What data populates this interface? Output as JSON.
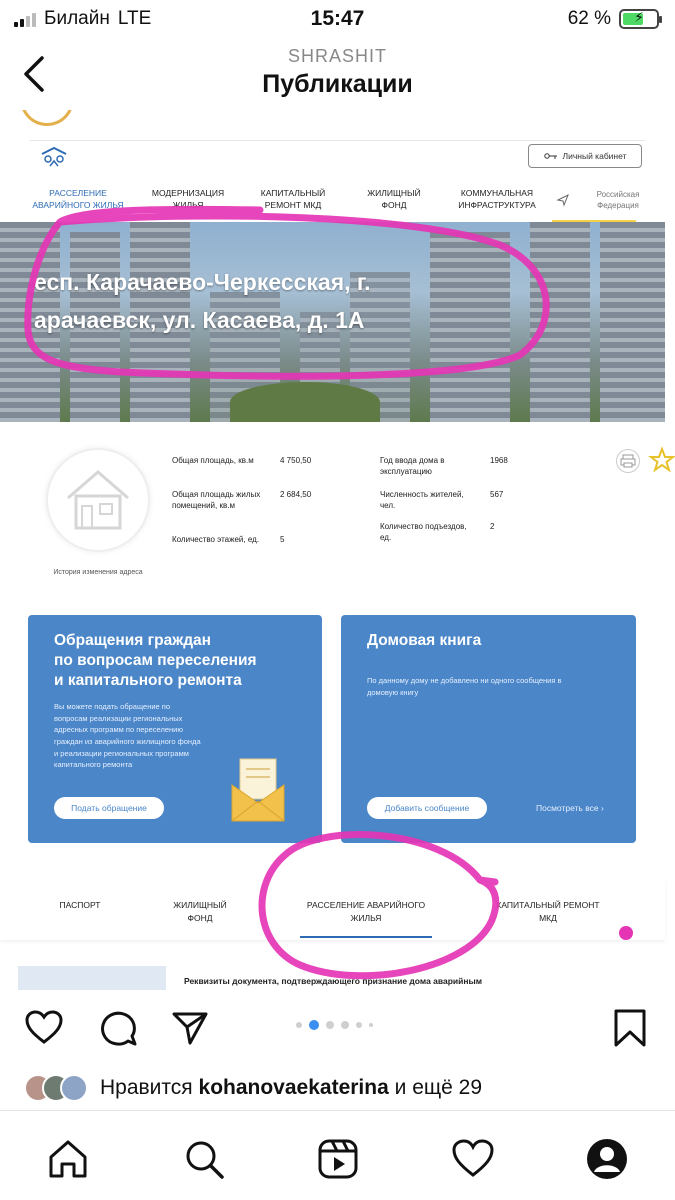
{
  "status_bar": {
    "carrier": "Билайн",
    "network": "LTE",
    "time": "15:47",
    "battery": "62 %",
    "battery_level": 0.62,
    "battery_color": "#4cd964"
  },
  "header": {
    "username": "SHRASHIT",
    "title": "Публикации",
    "back_icon": "chevron-left-icon"
  },
  "post": {
    "site": {
      "cabinet_label": "Личный кабинет",
      "nav": [
        {
          "label": "Расселение аварийного жилья",
          "line1": "Расселение",
          "line2": "аварийного жилья"
        },
        {
          "label": "Модернизация жилья",
          "line1": "Модернизация",
          "line2": "жилья"
        },
        {
          "label": "Капитальный ремонт МКД",
          "line1": "Капитальный",
          "line2": "ремонт МКД"
        },
        {
          "label": "Жилищный фонд",
          "line1": "Жилищный",
          "line2": "фонд"
        },
        {
          "label": "Коммунальная инфраструктура",
          "line1": "Коммунальная",
          "line2": "инфраструктура"
        },
        {
          "label": "Российская Федерация",
          "line1": "Российская",
          "line2": "Федерация"
        }
      ],
      "address_line1": "есп. Карачаево-Черкесская, г.",
      "address_line2": "арачаевск, ул. Касаева, д. 1А",
      "photo_caption": "История изменения адреса",
      "properties_left": [
        {
          "label": "Общая площадь, кв.м",
          "value": "4 750,50"
        },
        {
          "label": "Общая площадь жилых помещений, кв.м",
          "value": "2 684,50"
        },
        {
          "label": "Количество этажей, ед.",
          "value": "5"
        }
      ],
      "properties_right": [
        {
          "label": "Год ввода дома в эксплуатацию",
          "value": "1968"
        },
        {
          "label": "Численность жителей, чел.",
          "value": "567"
        },
        {
          "label": "Количество подъездов, ед.",
          "value": "2"
        }
      ],
      "card_appeal": {
        "title_line1": "Обращения граждан",
        "title_line2": "по вопросам переселения",
        "title_line3": "и капитального ремонта",
        "text_lines": [
          "Вы можете подать обращение по",
          "вопросам реализации региональных",
          "адресных программ по переселению",
          "граждан из аварийного жилищного фонда",
          "и реализации региональных программ",
          "капитального ремонта"
        ],
        "button": "Подать обращение"
      },
      "card_book": {
        "title": "Домовая книга",
        "text_line1": "По данному дому не добавлено ни одного сообщения в",
        "text_line2": "домовую книгу",
        "button": "Добавить сообщение",
        "see_all": "Посмотреть все ›"
      },
      "tabs": [
        {
          "line1": "Паспорт",
          "line2": ""
        },
        {
          "line1": "Жилищный",
          "line2": "фонд"
        },
        {
          "line1": "Расселение аварийного",
          "line2": "жилья"
        },
        {
          "line1": "Капитальный ремонт",
          "line2": "МКД"
        }
      ],
      "active_tab": "Расселение аварийного жилья",
      "document_title": "Реквизиты документа, подтверждающего признание дома аварийным"
    },
    "annotation_color": "#e535b5",
    "accent": "#4a86c8",
    "carousel": {
      "total": 6,
      "active": 2
    }
  },
  "likes": {
    "prefix": "Нравится",
    "user": "kohanovaekaterina",
    "suffix": "и ещё 29"
  },
  "actions": [
    "heart-icon",
    "comment-icon",
    "share-icon",
    "bookmark-icon"
  ],
  "tab_bar": [
    "home-icon",
    "search-icon",
    "reels-icon",
    "activity-icon",
    "profile-icon"
  ]
}
